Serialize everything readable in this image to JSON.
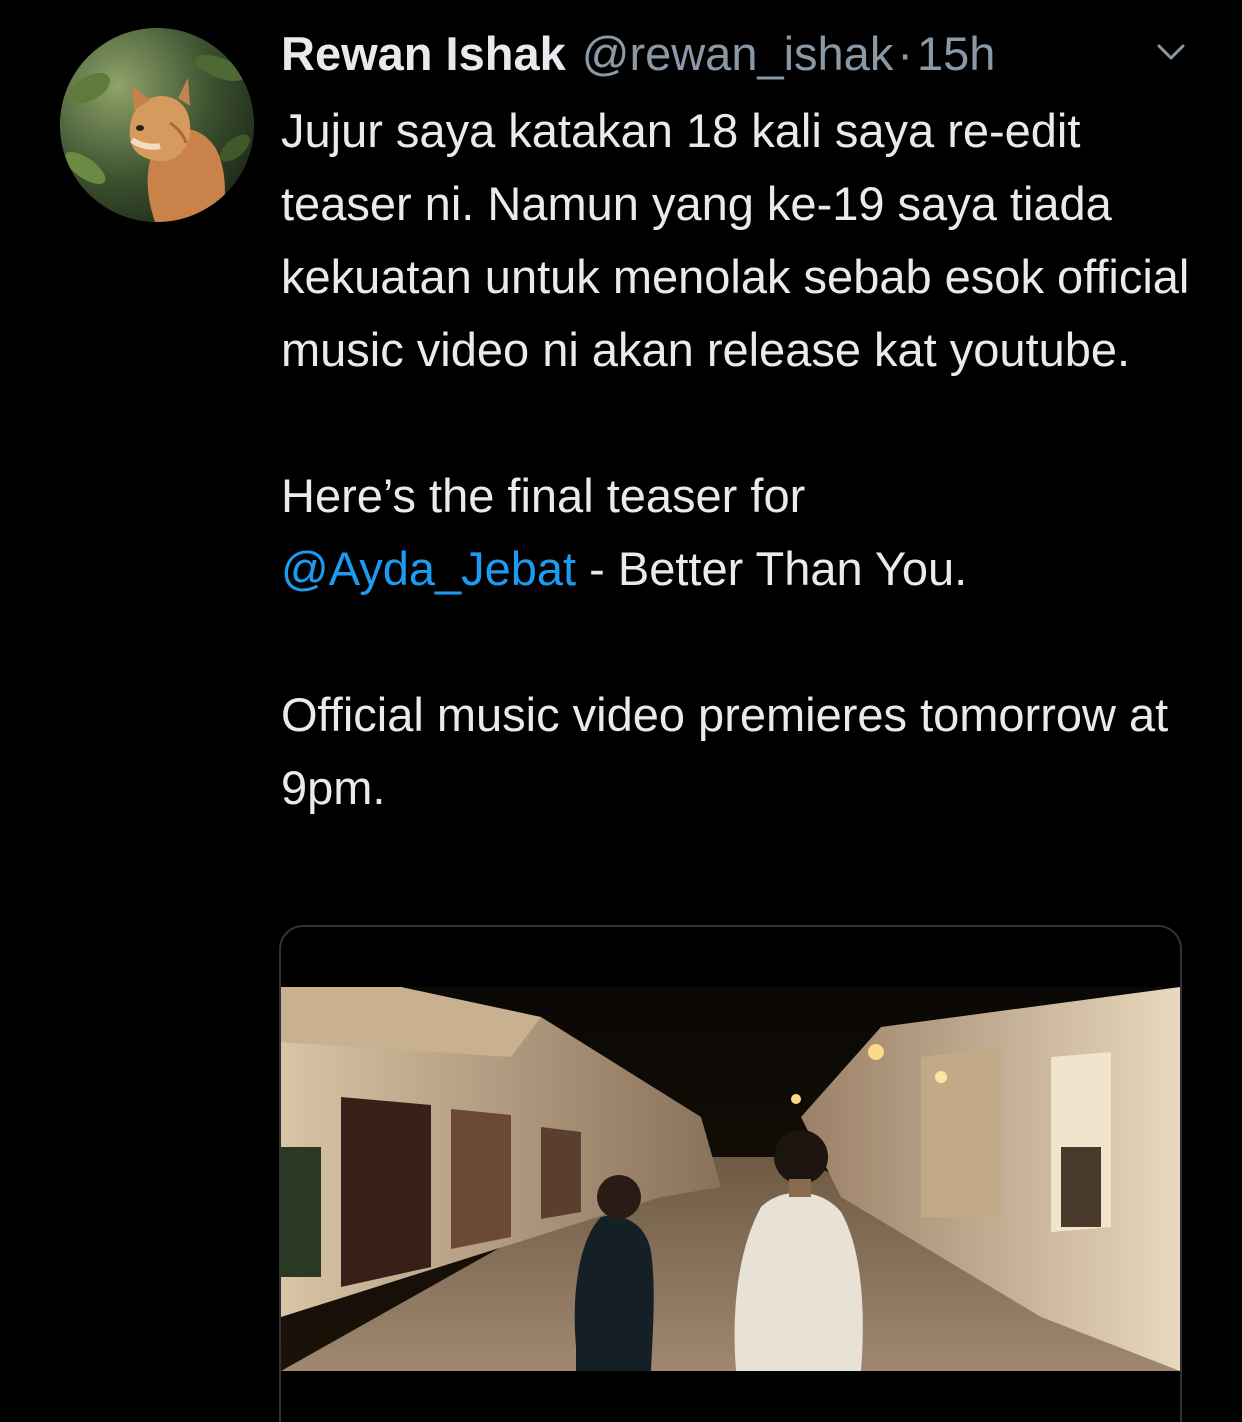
{
  "tweet": {
    "display_name": "Rewan Ishak",
    "handle": "@rewan_ishak",
    "separator": "·",
    "time": "15h",
    "body": {
      "p1": "Jujur saya katakan 18 kali saya re-edit teaser ni. Namun yang ke-19 saya tiada kekuatan untuk menolak sebab esok official music video ni akan release kat youtube.",
      "p2_prefix": "Here’s the final teaser for",
      "p2_mention": "@Ayda_Jebat",
      "p2_suffix": " - Better Than You.",
      "p3": "Official music video premieres tomorrow at 9pm."
    },
    "icons": {
      "avatar": "cat-photo-avatar",
      "menu": "chevron-down-icon",
      "media": "video-thumbnail"
    }
  },
  "colors": {
    "background": "#000000",
    "text": "#e8eaed",
    "secondary": "#8b98a5",
    "link": "#1d9bf0"
  }
}
